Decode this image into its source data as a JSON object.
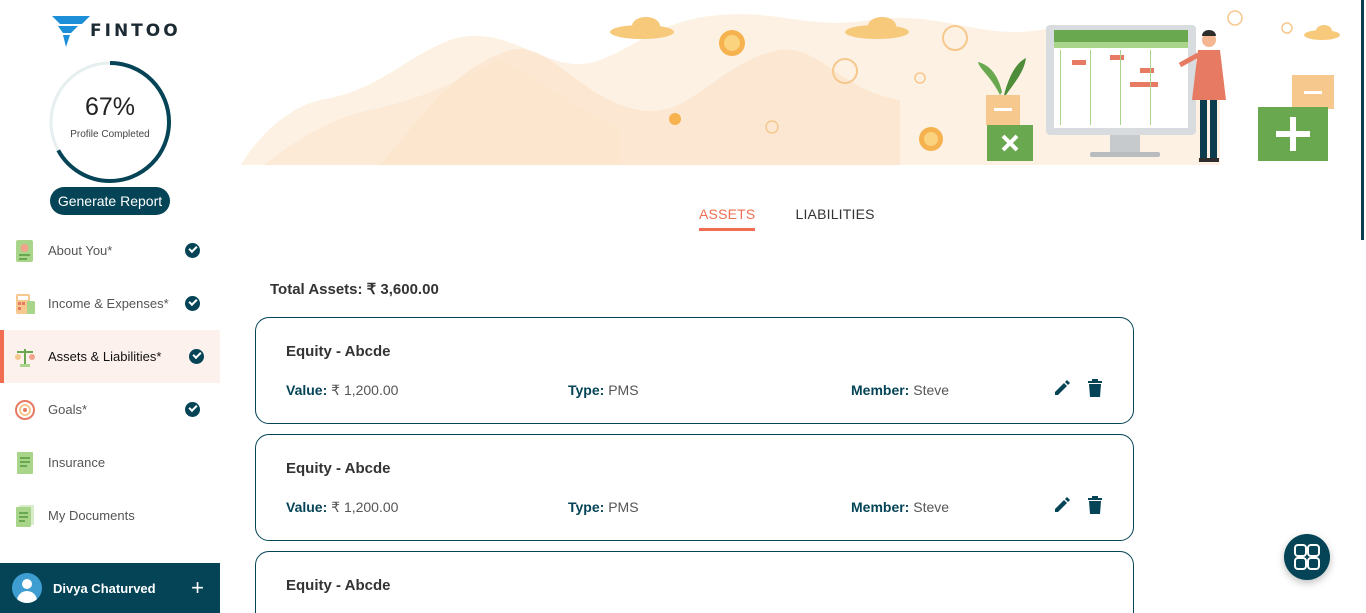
{
  "brand": {
    "name": "FINTOO"
  },
  "profile": {
    "percent_label": "67%",
    "caption": "Profile Completed",
    "percent": 67
  },
  "sidebar": {
    "generate_report": "Generate Report",
    "items": [
      {
        "label": "About You*",
        "icon": "about-you-icon",
        "completed": true
      },
      {
        "label": "Income & Expenses*",
        "icon": "calculator-icon",
        "completed": true
      },
      {
        "label": "Assets & Liabilities*",
        "icon": "scale-icon",
        "completed": true,
        "active": true
      },
      {
        "label": "Goals*",
        "icon": "target-icon",
        "completed": true
      },
      {
        "label": "Insurance",
        "icon": "document-icon",
        "completed": false
      },
      {
        "label": "My Documents",
        "icon": "documents-icon",
        "completed": false
      }
    ],
    "user": {
      "name": "Divya Chaturved",
      "add": "+"
    }
  },
  "tabs": [
    {
      "label": "ASSETS",
      "active": true
    },
    {
      "label": "LIABILITIES",
      "active": false
    }
  ],
  "summary": {
    "total_label": "Total Assets: ₹ 3,600.00"
  },
  "assets": [
    {
      "title": "Equity - Abcde",
      "value_label": "Value:",
      "value": "₹ 1,200.00",
      "type_label": "Type:",
      "type": "PMS",
      "member_label": "Member:",
      "member": "Steve"
    },
    {
      "title": "Equity - Abcde",
      "value_label": "Value:",
      "value": "₹ 1,200.00",
      "type_label": "Type:",
      "type": "PMS",
      "member_label": "Member:",
      "member": "Steve"
    },
    {
      "title": "Equity - Abcde"
    }
  ],
  "colors": {
    "primary": "#044456",
    "accent": "#f06d51",
    "banner_bg": "#fdf1e3",
    "check": "#044456"
  }
}
